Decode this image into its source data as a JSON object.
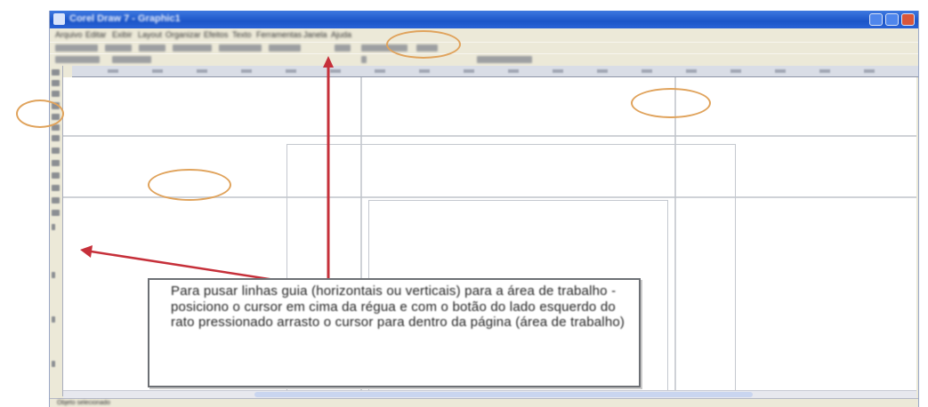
{
  "window": {
    "title": "Corel Draw 7 - Graphic1",
    "menu": [
      "Arquivo",
      "Editar",
      "Exibir",
      "Layout",
      "Organizar",
      "Efeitos",
      "Texto",
      "Ferramentas",
      "Janela",
      "Ajuda"
    ]
  },
  "status": "Objeto selecionado",
  "callout": {
    "text": "Para pusar linhas guia (horizontais ou verticais) para a área de trabalho - posiciono o cursor em cima da régua e com o botão do lado esquerdo do rato pressionado arrasto o cursor para dentro da página (área de trabalho)"
  },
  "colors": {
    "title_bar": "#2a63d6",
    "callout_border": "#6d7075",
    "highlight_oval": "#e0a35c",
    "arrow": "#c6303a",
    "guide_line": "#bfc3c9"
  },
  "icons": {
    "app": "corel-app-icon",
    "minimize": "minimize-icon",
    "maximize": "maximize-icon",
    "close": "close-icon"
  }
}
